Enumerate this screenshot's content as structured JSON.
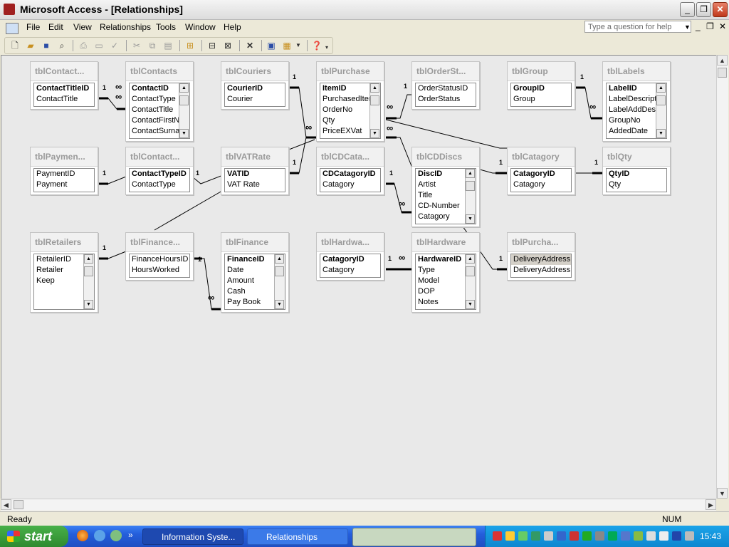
{
  "window": {
    "title": "Microsoft Access - [Relationships]"
  },
  "menu": [
    "File",
    "Edit",
    "View",
    "Relationships",
    "Tools",
    "Window",
    "Help"
  ],
  "help_box": {
    "placeholder": "Type a question for help"
  },
  "toolbar_icons": [
    "new-icon",
    "open-icon",
    "save-icon",
    "print-preview-icon",
    "print-icon",
    "preview-icon",
    "spelling-icon",
    "cut-icon",
    "copy-icon",
    "paste-icon",
    "show-table-icon",
    "show-direct-icon",
    "show-all-icon",
    "delete-icon",
    "database-window-icon",
    "new-object-icon",
    "help-icon"
  ],
  "tables": [
    {
      "name": "tblContact...",
      "fields": [
        "ContactTitleID",
        "ContactTitle"
      ],
      "pk": 1
    },
    {
      "name": "tblContacts",
      "fields": [
        "ContactID",
        "ContactType",
        "ContactTitle",
        "ContactFirstN",
        "ContactSurna"
      ],
      "pk": 1
    },
    {
      "name": "tblCouriers",
      "fields": [
        "CourierID",
        "Courier"
      ],
      "pk": 1
    },
    {
      "name": "tblPurchase",
      "fields": [
        "ItemID",
        "PurchasedIter",
        "OrderNo",
        "Qty",
        "PriceEXVat"
      ],
      "pk": 1
    },
    {
      "name": "tblOrderSt...",
      "fields": [
        "OrderStatusID",
        "OrderStatus"
      ],
      "pk": 0
    },
    {
      "name": "tblGroup",
      "fields": [
        "GroupID",
        "Group"
      ],
      "pk": 1
    },
    {
      "name": "tblLabels",
      "fields": [
        "LabelID",
        "LabelDescription",
        "LabelAddDescript",
        "GroupNo",
        "AddedDate"
      ],
      "pk": 1
    },
    {
      "name": "tblPaymen...",
      "fields": [
        "PaymentID",
        "Payment"
      ],
      "pk": 0
    },
    {
      "name": "tblContact...",
      "fields": [
        "ContactTypeID",
        "ContactType"
      ],
      "pk": 1
    },
    {
      "name": "tblVATRate",
      "fields": [
        "VATID",
        "VAT Rate"
      ],
      "pk": 1
    },
    {
      "name": "tblCDCata...",
      "fields": [
        "CDCatagoryID",
        "Catagory"
      ],
      "pk": 1
    },
    {
      "name": "tblCDDiscs",
      "fields": [
        "DiscID",
        "Artist",
        "Title",
        "CD-Number",
        "Catagory"
      ],
      "pk": 1
    },
    {
      "name": "tblCatagory",
      "fields": [
        "CatagoryID",
        "Catagory"
      ],
      "pk": 1
    },
    {
      "name": "tblQty",
      "fields": [
        "QtyID",
        "Qty"
      ],
      "pk": 1
    },
    {
      "name": "tblRetailers",
      "fields": [
        "RetailerID",
        "Retailer",
        "Keep"
      ],
      "pk": 0
    },
    {
      "name": "tblFinance...",
      "fields": [
        "FinanceHoursID",
        "HoursWorked"
      ],
      "pk": 0
    },
    {
      "name": "tblFinance",
      "fields": [
        "FinanceID",
        "Date",
        "Amount",
        "Cash",
        "Pay Book"
      ],
      "pk": 1
    },
    {
      "name": "tblHardwa...",
      "fields": [
        "CatagoryID",
        "Catagory"
      ],
      "pk": 1
    },
    {
      "name": "tblHardware",
      "fields": [
        "HardwareID",
        "Type",
        "Model",
        "DOP",
        "Notes"
      ],
      "pk": 1
    },
    {
      "name": "tblPurcha...",
      "fields": [
        "DeliveryAddressI",
        "DeliveryAddress"
      ],
      "pk": 0,
      "selected": 0
    }
  ],
  "relation_labels": {
    "one": "1",
    "many": "∞"
  },
  "status": {
    "ready": "Ready",
    "num": "NUM"
  },
  "taskbar": {
    "start": "start",
    "tasks": [
      "Information Syste...",
      "Relationships"
    ],
    "clock": "15:43"
  }
}
